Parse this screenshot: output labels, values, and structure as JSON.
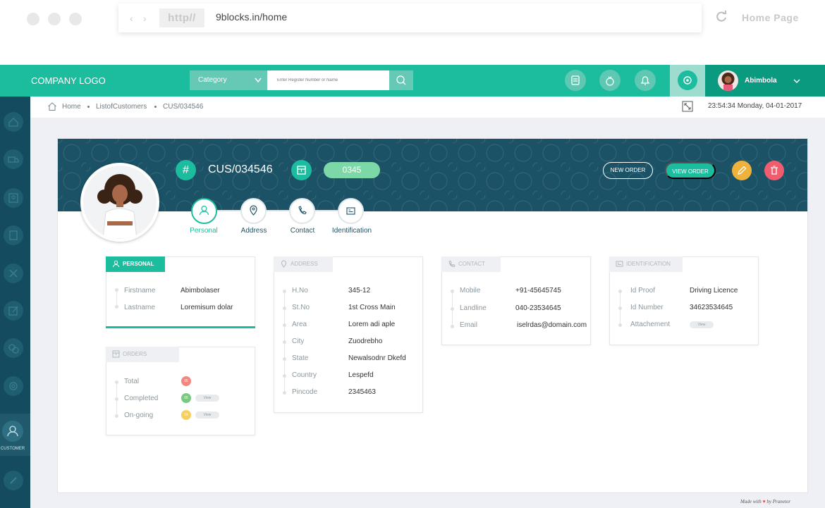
{
  "browser": {
    "protocol": "http//",
    "url": "9blocks.in/home",
    "page_title": "Home Page"
  },
  "appbar": {
    "logo": "COMPANY LOGO",
    "category_label": "Category",
    "search_placeholder": "Enter Register Number or Name",
    "user_name": "Abimbola"
  },
  "sidebar": {
    "active_label": "CUSTOMER"
  },
  "breadcrumb": {
    "items": [
      "Home",
      "ListofCustomers",
      "CUS/034546"
    ],
    "datetime": "23:54:34  Monday, 04-01-2017"
  },
  "customer": {
    "id": "CUS/034546",
    "code": "0345",
    "new_order_label": "NEW ORDER",
    "view_order_label": "VIEW ORDER"
  },
  "steps": [
    "Personal",
    "Address",
    "Contact",
    "Identification"
  ],
  "personal": {
    "title": "PERSONAL",
    "fields": [
      {
        "label": "Firstname",
        "value": "Abimbolaser"
      },
      {
        "label": "Lastname",
        "value": "Loremisum dolar"
      }
    ]
  },
  "orders": {
    "title": "ORDERS",
    "rows": [
      {
        "label": "Total",
        "count": "05",
        "color": "#f2877f"
      },
      {
        "label": "Completed",
        "count": "05",
        "color": "#7ac77e",
        "action": "View"
      },
      {
        "label": "On-going",
        "count": "04",
        "color": "#f7cf5e",
        "action": "View"
      }
    ]
  },
  "address": {
    "title": "ADDRESS",
    "fields": [
      {
        "label": "H.No",
        "value": "345-12"
      },
      {
        "label": "St.No",
        "value": "1st Cross Main"
      },
      {
        "label": "Area",
        "value": "Lorem adi aple"
      },
      {
        "label": "City",
        "value": "Zuodrebho"
      },
      {
        "label": "State",
        "value": "Newalsodnr Dkefd"
      },
      {
        "label": "Country",
        "value": "Lespefd"
      },
      {
        "label": "Pincode",
        "value": "2345463"
      }
    ]
  },
  "contact": {
    "title": "CONTACT",
    "fields": [
      {
        "label": "Mobile",
        "value": "+91-45645745"
      },
      {
        "label": "Landline",
        "value": "040-23534645"
      },
      {
        "label": "Email",
        "value": "iselrdas@domain.com"
      }
    ]
  },
  "identification": {
    "title": "IDENTIFICATION",
    "fields": [
      {
        "label": "Id Proof",
        "value": "Driving Licence"
      },
      {
        "label": "Id Number",
        "value": "34623534645"
      },
      {
        "label": "Attachement",
        "value": "View"
      }
    ]
  },
  "footer": {
    "made_with": "Made with",
    "by": "by Pranetor"
  },
  "colors": {
    "primary": "#1cbc9e",
    "dark": "#1b5266",
    "sidebar": "#144b5e"
  }
}
